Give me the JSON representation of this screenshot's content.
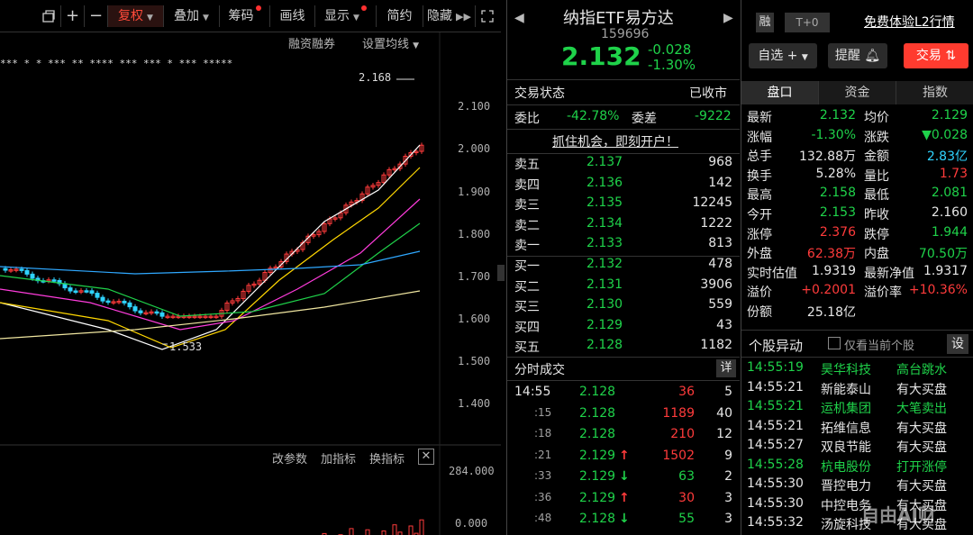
{
  "toolbar": {
    "items": [
      {
        "label": "复权",
        "active": true,
        "caret": true,
        "dot": false
      },
      {
        "label": "叠加",
        "active": false,
        "caret": true,
        "dot": false
      },
      {
        "label": "筹码",
        "active": false,
        "caret": false,
        "dot": true
      },
      {
        "label": "画线",
        "active": false,
        "caret": false,
        "dot": false
      },
      {
        "label": "显示",
        "active": false,
        "caret": true,
        "dot": true
      },
      {
        "label": "简约",
        "active": false,
        "caret": false,
        "dot": false
      },
      {
        "label": "隐藏",
        "active": false,
        "caret": false,
        "dot": false
      }
    ],
    "icons": [
      "window-icon",
      "plus-icon",
      "minus-icon",
      "fast-forward-icon",
      "fullscreen-icon"
    ]
  },
  "chart": {
    "submenu": {
      "margin": "融资融券",
      "ma_settings": "设置均线"
    },
    "price_axis": [
      "2.100",
      "2.000",
      "1.900",
      "1.800",
      "1.700",
      "1.600",
      "1.500",
      "1.400"
    ],
    "high_marker": "2.168",
    "low_marker": "1.533",
    "indicator_bar": {
      "change_params": "改参数",
      "add_indicator": "加指标",
      "switch_indicator": "换指标"
    },
    "volume_axis": [
      "284.000",
      "0.000"
    ]
  },
  "chart_data": {
    "type": "candlestick",
    "price_axis_ticks": [
      2.1,
      2.0,
      1.9,
      1.8,
      1.7,
      1.6,
      1.5,
      1.4
    ],
    "high": 2.168,
    "low": 1.533,
    "volume_axis_ticks": [
      284.0,
      0.0
    ]
  },
  "quote": {
    "name": "纳指ETF易方达",
    "code": "159696",
    "price": "2.132",
    "change": "-0.028",
    "change_pct": "-1.30%"
  },
  "status": {
    "trade_status_label": "交易状态",
    "trade_status_value": "已收市",
    "weibi_label": "委比",
    "weibi_value": "-42.78%",
    "weicha_label": "委差",
    "weicha_value": "-9222",
    "promo": "抓住机会，即刻开户！"
  },
  "sell_orders": [
    {
      "label": "卖五",
      "price": "2.137",
      "volume": "968"
    },
    {
      "label": "卖四",
      "price": "2.136",
      "volume": "142"
    },
    {
      "label": "卖三",
      "price": "2.135",
      "volume": "12245"
    },
    {
      "label": "卖二",
      "price": "2.134",
      "volume": "1222"
    },
    {
      "label": "卖一",
      "price": "2.133",
      "volume": "813"
    }
  ],
  "buy_orders": [
    {
      "label": "买一",
      "price": "2.132",
      "volume": "478"
    },
    {
      "label": "买二",
      "price": "2.131",
      "volume": "3906"
    },
    {
      "label": "买三",
      "price": "2.130",
      "volume": "559"
    },
    {
      "label": "买四",
      "price": "2.129",
      "volume": "43"
    },
    {
      "label": "买五",
      "price": "2.128",
      "volume": "1182"
    }
  ],
  "ticks": {
    "title": "分时成交",
    "detail_btn": "详",
    "rows": [
      {
        "time": "14:55",
        "price": "2.128",
        "arrow": "",
        "vol": "36",
        "n": "5",
        "dir": "red"
      },
      {
        "time": ":15",
        "price": "2.128",
        "arrow": "",
        "vol": "1189",
        "n": "40",
        "dir": "red"
      },
      {
        "time": ":18",
        "price": "2.128",
        "arrow": "",
        "vol": "210",
        "n": "12",
        "dir": "red"
      },
      {
        "time": ":21",
        "price": "2.129",
        "arrow": "↑",
        "vol": "1502",
        "n": "9",
        "dir": "red"
      },
      {
        "time": ":33",
        "price": "2.129",
        "arrow": "↓",
        "vol": "63",
        "n": "2",
        "dir": "green"
      },
      {
        "time": ":36",
        "price": "2.129",
        "arrow": "↑",
        "vol": "30",
        "n": "3",
        "dir": "red"
      },
      {
        "time": ":48",
        "price": "2.128",
        "arrow": "↓",
        "vol": "55",
        "n": "3",
        "dir": "green"
      }
    ]
  },
  "right_header": {
    "rong": "融",
    "t0": "T+0",
    "free_trial": "免费体验L2行情",
    "watchlist": "自选",
    "alert": "提醒",
    "trade": "交易"
  },
  "tabs": [
    "盘口",
    "资金",
    "指数"
  ],
  "stats": [
    {
      "l1": "最新",
      "v1": "2.132",
      "c1": "green",
      "l2": "均价",
      "v2": "2.129",
      "c2": "green"
    },
    {
      "l1": "涨幅",
      "v1": "-1.30%",
      "c1": "green",
      "l2": "涨跌",
      "v2": "▼0.028",
      "c2": "green"
    },
    {
      "l1": "总手",
      "v1": "132.88万",
      "c1": "white",
      "l2": "金额",
      "v2": "2.83亿",
      "c2": "cyan"
    },
    {
      "l1": "换手",
      "v1": "5.28%",
      "c1": "white",
      "l2": "量比",
      "v2": "1.73",
      "c2": "red"
    },
    {
      "l1": "最高",
      "v1": "2.158",
      "c1": "green",
      "l2": "最低",
      "v2": "2.081",
      "c2": "green"
    },
    {
      "l1": "今开",
      "v1": "2.153",
      "c1": "green",
      "l2": "昨收",
      "v2": "2.160",
      "c2": "white"
    },
    {
      "l1": "涨停",
      "v1": "2.376",
      "c1": "red",
      "l2": "跌停",
      "v2": "1.944",
      "c2": "green"
    },
    {
      "l1": "外盘",
      "v1": "62.38万",
      "c1": "red",
      "l2": "内盘",
      "v2": "70.50万",
      "c2": "green"
    },
    {
      "l1": "实时估值",
      "v1": "1.9319",
      "c1": "white",
      "l2": "最新净值",
      "v2": "1.9317",
      "c2": "white"
    },
    {
      "l1": "溢价",
      "v1": "+0.2001",
      "c1": "red",
      "l2": "溢价率",
      "v2": "+10.36%",
      "c2": "red"
    },
    {
      "l1": "份额",
      "v1": "25.18亿",
      "c1": "white",
      "l2": "",
      "v2": "",
      "c2": "white"
    }
  ],
  "moves": {
    "title": "个股异动",
    "only_current": "仅看当前个股",
    "settings": "设",
    "rows": [
      {
        "time": "14:55:19",
        "name": "昊华科技",
        "event": "高台跳水",
        "color": "green"
      },
      {
        "time": "14:55:21",
        "name": "新能泰山",
        "event": "有大买盘",
        "color": "white"
      },
      {
        "time": "14:55:21",
        "name": "运机集团",
        "event": "大笔卖出",
        "color": "green"
      },
      {
        "time": "14:55:21",
        "name": "拓维信息",
        "event": "有大买盘",
        "color": "white"
      },
      {
        "time": "14:55:27",
        "name": "双良节能",
        "event": "有大买盘",
        "color": "white"
      },
      {
        "time": "14:55:28",
        "name": "杭电股份",
        "event": "打开涨停",
        "color": "green"
      },
      {
        "time": "14:55:30",
        "name": "晋控电力",
        "event": "有大买盘",
        "color": "white"
      },
      {
        "time": "14:55:30",
        "name": "中控电务",
        "event": "有大买盘",
        "color": "white"
      },
      {
        "time": "14:55:32",
        "name": "汤旋科技",
        "event": "有大买盘",
        "color": "white"
      }
    ]
  },
  "watermark": "自由AI财"
}
